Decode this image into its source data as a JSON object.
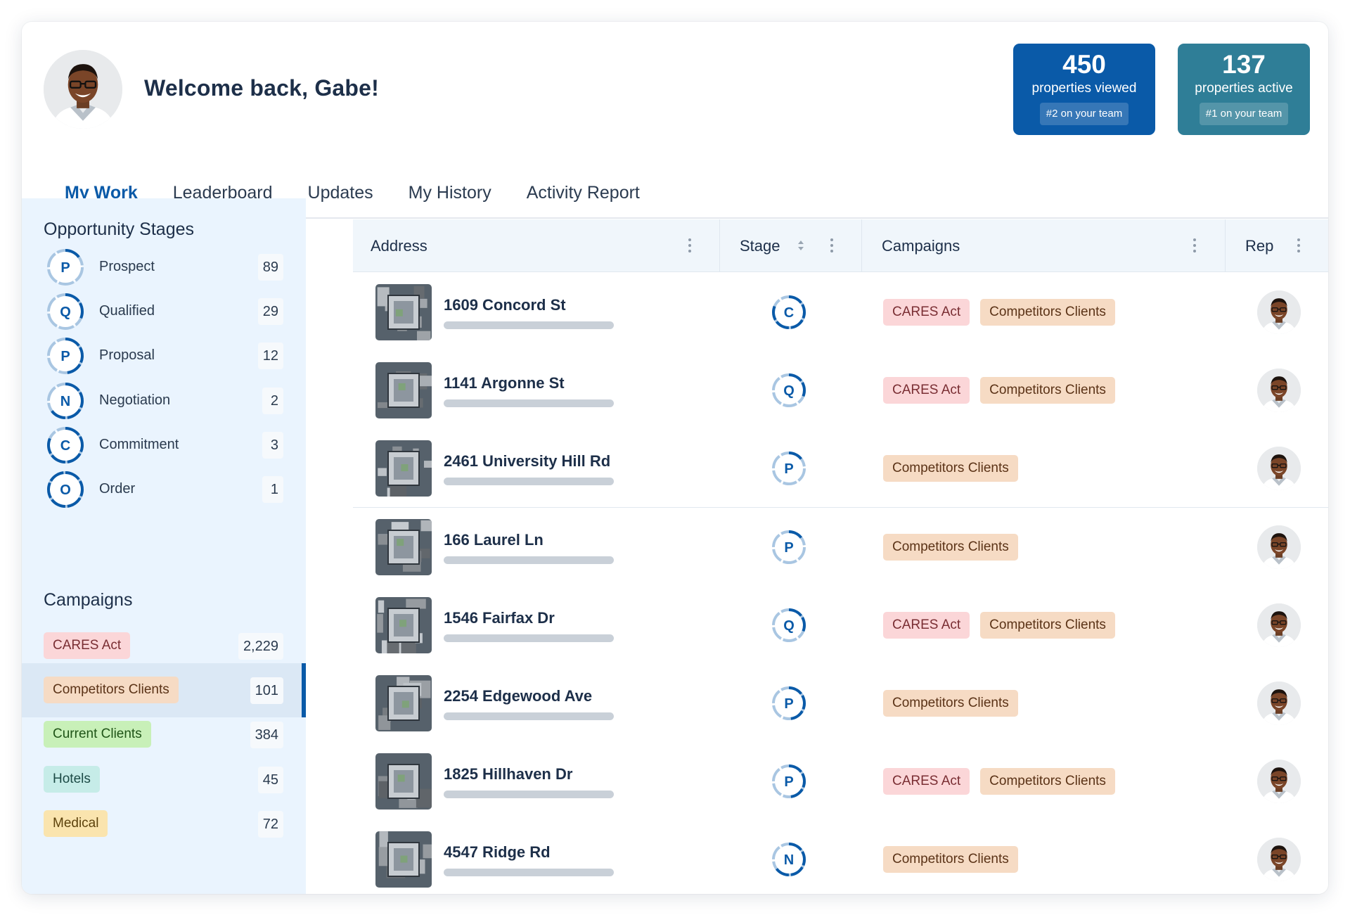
{
  "header": {
    "welcome": "Welcome back, Gabe!",
    "stats": [
      {
        "value": "450",
        "label": "properties viewed",
        "rank": "#2 on your team",
        "color": "#0a5aa8"
      },
      {
        "value": "137",
        "label": "properties active",
        "rank": "#1 on your team",
        "color": "#2f7e97"
      }
    ]
  },
  "tabs": [
    "My Work",
    "Leaderboard",
    "Updates",
    "My History",
    "Activity Report"
  ],
  "active_tab": "My Work",
  "sidebar": {
    "stages_title": "Opportunity Stages",
    "stages": [
      {
        "letter": "P",
        "name": "Prospect",
        "count": "89",
        "progress": 0.17
      },
      {
        "letter": "Q",
        "name": "Qualified",
        "count": "29",
        "progress": 0.33
      },
      {
        "letter": "P",
        "name": "Proposal",
        "count": "12",
        "progress": 0.5
      },
      {
        "letter": "N",
        "name": "Negotiation",
        "count": "2",
        "progress": 0.67
      },
      {
        "letter": "C",
        "name": "Commitment",
        "count": "3",
        "progress": 0.83
      },
      {
        "letter": "O",
        "name": "Order",
        "count": "1",
        "progress": 1.0
      }
    ],
    "campaigns_title": "Campaigns",
    "campaigns": [
      {
        "name": "CARES Act",
        "count": "2,229",
        "kind": "cares"
      },
      {
        "name": "Competitors Clients",
        "count": "101",
        "kind": "competitors",
        "selected": true
      },
      {
        "name": "Current Clients",
        "count": "384",
        "kind": "current"
      },
      {
        "name": "Hotels",
        "count": "45",
        "kind": "hotels"
      },
      {
        "name": "Medical",
        "count": "72",
        "kind": "medical"
      }
    ]
  },
  "table": {
    "headers": {
      "address": "Address",
      "stage": "Stage",
      "campaigns": "Campaigns",
      "rep": "Rep"
    },
    "rows": [
      {
        "address": "1609 Concord St",
        "stage": "C",
        "stage_progress": 0.83,
        "campaigns": [
          "CARES Act",
          "Competitors Clients"
        ]
      },
      {
        "address": "1141 Argonne St",
        "stage": "Q",
        "stage_progress": 0.33,
        "campaigns": [
          "CARES Act",
          "Competitors Clients"
        ]
      },
      {
        "address": "2461 University Hill Rd",
        "stage": "P",
        "stage_progress": 0.17,
        "campaigns": [
          "Competitors Clients"
        ]
      },
      {
        "address": "166 Laurel Ln",
        "stage": "P",
        "stage_progress": 0.17,
        "campaigns": [
          "Competitors Clients"
        ]
      },
      {
        "address": "1546 Fairfax Dr",
        "stage": "Q",
        "stage_progress": 0.33,
        "campaigns": [
          "CARES Act",
          "Competitors Clients"
        ]
      },
      {
        "address": "2254 Edgewood Ave",
        "stage": "P",
        "stage_progress": 0.5,
        "campaigns": [
          "Competitors Clients"
        ]
      },
      {
        "address": "1825 Hillhaven Dr",
        "stage": "P",
        "stage_progress": 0.5,
        "campaigns": [
          "CARES Act",
          "Competitors Clients"
        ]
      },
      {
        "address": "4547 Ridge Rd",
        "stage": "N",
        "stage_progress": 0.67,
        "campaigns": [
          "Competitors Clients"
        ]
      }
    ]
  },
  "icons": {
    "avatar": "person-avatar",
    "kebab": "kebab-menu-icon",
    "sort": "sort-icon",
    "thumbnail": "aerial-building-photo"
  },
  "colors": {
    "primary": "#0a5aa8",
    "teal": "#2f7e97",
    "sidebar_bg": "#eaf4fe"
  }
}
